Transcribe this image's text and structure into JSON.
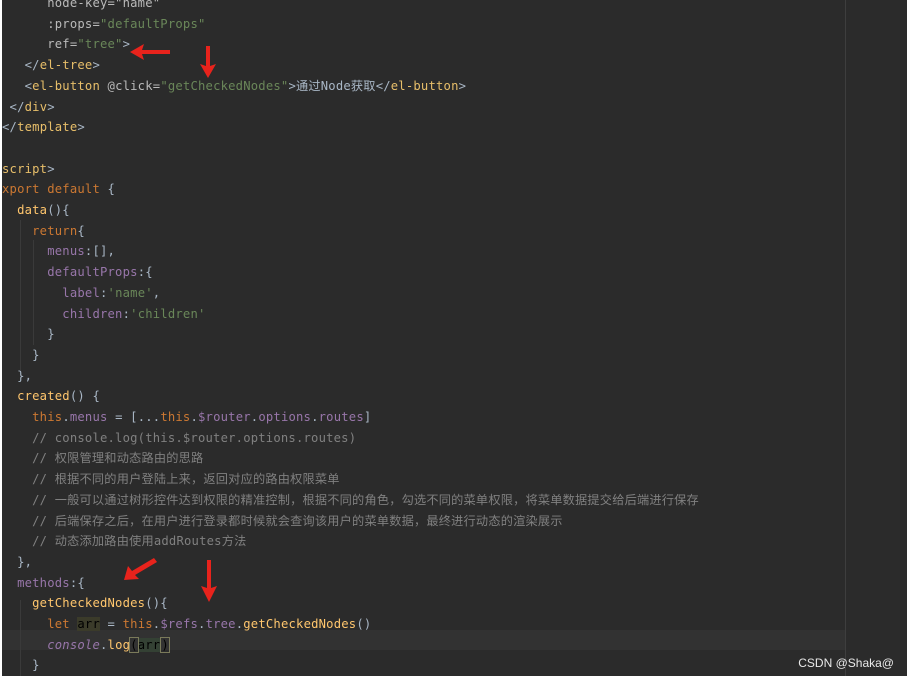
{
  "editor": {
    "lines": [
      {
        "tokens": [
          [
            "attr",
            "      node-key=\"name\""
          ]
        ]
      },
      {
        "tokens": [
          [
            "attr",
            "      :props="
          ],
          [
            "str",
            "\"defaultProps\""
          ]
        ]
      },
      {
        "tokens": [
          [
            "attr",
            "      ref="
          ],
          [
            "str",
            "\"tree\""
          ],
          [
            "punct",
            ">"
          ]
        ]
      },
      {
        "tokens": [
          [
            "punct",
            "   </"
          ],
          [
            "tag",
            "el-tree"
          ],
          [
            "punct",
            ">"
          ]
        ]
      },
      {
        "tokens": [
          [
            "punct",
            "   <"
          ],
          [
            "tag",
            "el-button"
          ],
          [
            "attr",
            " @click="
          ],
          [
            "str",
            "\"getCheckedNodes\""
          ],
          [
            "punct",
            ">通过Node获取</"
          ],
          [
            "tag",
            "el-button"
          ],
          [
            "punct",
            ">"
          ]
        ]
      },
      {
        "tokens": [
          [
            "punct",
            " </"
          ],
          [
            "tag",
            "div"
          ],
          [
            "punct",
            ">"
          ]
        ]
      },
      {
        "tokens": [
          [
            "punct",
            "</"
          ],
          [
            "tag",
            "template"
          ],
          [
            "punct",
            ">"
          ]
        ]
      },
      {
        "tokens": [
          [
            "punct",
            ""
          ]
        ]
      },
      {
        "tokens": [
          [
            "tag",
            "script"
          ],
          [
            "punct",
            ">"
          ]
        ]
      },
      {
        "tokens": [
          [
            "kw",
            "xport default "
          ],
          [
            "punct",
            "{"
          ]
        ]
      },
      {
        "tokens": [
          [
            "fn",
            "  data"
          ],
          [
            "punct",
            "(){"
          ]
        ]
      },
      {
        "tokens": [
          [
            "kw",
            "    return"
          ],
          [
            "punct",
            "{"
          ]
        ]
      },
      {
        "tokens": [
          [
            "prop",
            "      menus"
          ],
          [
            "punct",
            ":[],"
          ]
        ]
      },
      {
        "tokens": [
          [
            "prop",
            "      defaultProps"
          ],
          [
            "punct",
            ":{"
          ]
        ]
      },
      {
        "tokens": [
          [
            "prop",
            "        label"
          ],
          [
            "punct",
            ":"
          ],
          [
            "str",
            "'name'"
          ],
          [
            "punct",
            ","
          ]
        ]
      },
      {
        "tokens": [
          [
            "prop",
            "        children"
          ],
          [
            "punct",
            ":"
          ],
          [
            "str",
            "'children'"
          ]
        ]
      },
      {
        "tokens": [
          [
            "punct",
            "      }"
          ]
        ]
      },
      {
        "tokens": [
          [
            "punct",
            "    }"
          ]
        ]
      },
      {
        "tokens": [
          [
            "punct",
            "  },"
          ]
        ]
      },
      {
        "tokens": [
          [
            "fn",
            "  created"
          ],
          [
            "punct",
            "() {"
          ]
        ]
      },
      {
        "tokens": [
          [
            "kw",
            "    this"
          ],
          [
            "punct",
            "."
          ],
          [
            "prop",
            "menus"
          ],
          [
            "punct",
            " = [..."
          ],
          [
            "kw",
            "this"
          ],
          [
            "punct",
            "."
          ],
          [
            "prop",
            "$router"
          ],
          [
            "punct",
            "."
          ],
          [
            "prop",
            "options"
          ],
          [
            "punct",
            "."
          ],
          [
            "prop",
            "routes"
          ],
          [
            "punct",
            "]"
          ]
        ]
      },
      {
        "tokens": [
          [
            "cmt",
            "    // console.log(this.$router.options.routes)"
          ]
        ]
      },
      {
        "tokens": [
          [
            "cmt",
            "    // 权限管理和动态路由的思路"
          ]
        ]
      },
      {
        "tokens": [
          [
            "cmt",
            "    // 根据不同的用户登陆上来，返回对应的路由权限菜单"
          ]
        ]
      },
      {
        "tokens": [
          [
            "cmt",
            "    // 一般可以通过树形控件达到权限的精准控制，根据不同的角色，勾选不同的菜单权限，将菜单数据提交给后端进行保存"
          ]
        ]
      },
      {
        "tokens": [
          [
            "cmt",
            "    // 后端保存之后，在用户进行登录都时候就会查询该用户的菜单数据，最终进行动态的渲染展示"
          ]
        ]
      },
      {
        "tokens": [
          [
            "cmt",
            "    // 动态添加路由使用addRoutes方法"
          ]
        ]
      },
      {
        "tokens": [
          [
            "punct",
            "  },"
          ]
        ]
      },
      {
        "tokens": [
          [
            "prop",
            "  methods"
          ],
          [
            "punct",
            ":{"
          ]
        ]
      },
      {
        "tokens": [
          [
            "fn",
            "    getCheckedNodes"
          ],
          [
            "punct",
            "(){"
          ]
        ]
      },
      {
        "tokens": [
          [
            "kw",
            "      let "
          ],
          [
            "hl",
            "arr"
          ],
          [
            "punct",
            " = "
          ],
          [
            "kw",
            "this"
          ],
          [
            "punct",
            "."
          ],
          [
            "prop",
            "$refs"
          ],
          [
            "punct",
            "."
          ],
          [
            "prop",
            "tree"
          ],
          [
            "punct",
            "."
          ],
          [
            "fn",
            "getCheckedNodes"
          ],
          [
            "punct",
            "()"
          ]
        ]
      },
      {
        "tokens": [
          [
            "prop ital",
            "      console"
          ],
          [
            "punct",
            "."
          ],
          [
            "fn",
            "log"
          ],
          [
            "brace",
            "("
          ],
          [
            "hl2",
            "arr"
          ],
          [
            "brace",
            ")"
          ]
        ]
      },
      {
        "tokens": [
          [
            "punct",
            "    }"
          ]
        ]
      }
    ]
  },
  "watermark": "CSDN @Shaka@",
  "colors": {
    "background": "#2b2b2b",
    "arrow": "#e8231c"
  }
}
